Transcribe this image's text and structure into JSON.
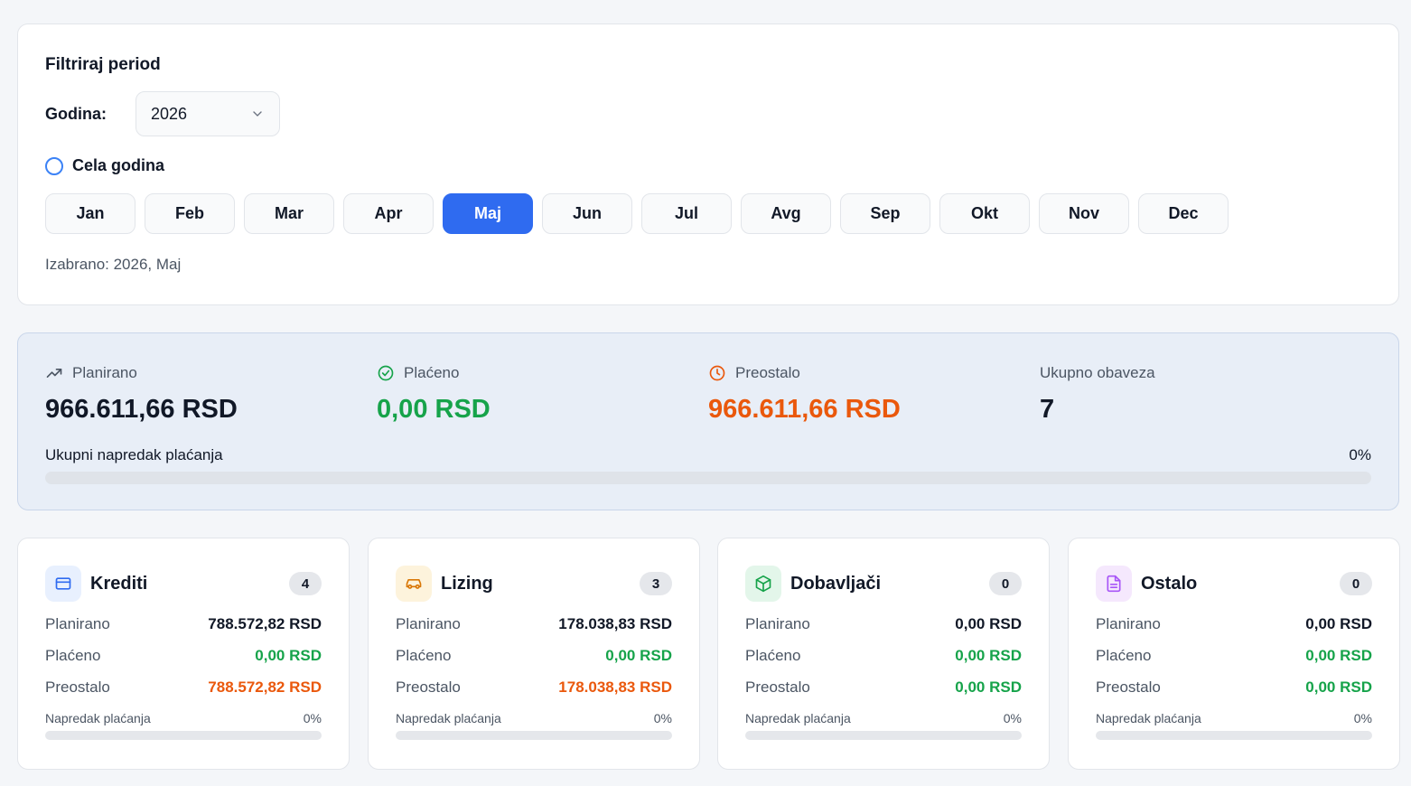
{
  "filter": {
    "title": "Filtriraj period",
    "year_label": "Godina:",
    "year_value": "2026",
    "full_year_label": "Cela godina",
    "months": [
      "Jan",
      "Feb",
      "Mar",
      "Apr",
      "Maj",
      "Jun",
      "Jul",
      "Avg",
      "Sep",
      "Okt",
      "Nov",
      "Dec"
    ],
    "active_month": "Maj",
    "selected_text": "Izabrano: 2026, Maj"
  },
  "summary": {
    "planned_label": "Planirano",
    "planned_value": "966.611,66 RSD",
    "paid_label": "Plaćeno",
    "paid_value": "0,00 RSD",
    "remaining_label": "Preostalo",
    "remaining_value": "966.611,66 RSD",
    "total_label": "Ukupno obaveza",
    "total_value": "7",
    "progress_label": "Ukupni napredak plaćanja",
    "progress_percent": "0%",
    "progress_fraction": 0
  },
  "categories": [
    {
      "title": "Krediti",
      "count": "4",
      "icon": "credit-card-icon",
      "icon_bg": "#e8f0fe",
      "icon_color": "#2f6bf0",
      "planned_label": "Planirano",
      "planned_value": "788.572,82 RSD",
      "paid_label": "Plaćeno",
      "paid_value": "0,00 RSD",
      "remaining_label": "Preostalo",
      "remaining_value": "788.572,82 RSD",
      "remaining_color": "#ea580c",
      "progress_label": "Napredak plaćanja",
      "progress_percent": "0%",
      "progress_fraction": 0
    },
    {
      "title": "Lizing",
      "count": "3",
      "icon": "car-icon",
      "icon_bg": "#fdf3dc",
      "icon_color": "#d97706",
      "planned_label": "Planirano",
      "planned_value": "178.038,83 RSD",
      "paid_label": "Plaćeno",
      "paid_value": "0,00 RSD",
      "remaining_label": "Preostalo",
      "remaining_value": "178.038,83 RSD",
      "remaining_color": "#ea580c",
      "progress_label": "Napredak plaćanja",
      "progress_percent": "0%",
      "progress_fraction": 0
    },
    {
      "title": "Dobavljači",
      "count": "0",
      "icon": "package-icon",
      "icon_bg": "#e3f6ea",
      "icon_color": "#16a34a",
      "planned_label": "Planirano",
      "planned_value": "0,00 RSD",
      "paid_label": "Plaćeno",
      "paid_value": "0,00 RSD",
      "remaining_label": "Preostalo",
      "remaining_value": "0,00 RSD",
      "remaining_color": "#16a34a",
      "progress_label": "Napredak plaćanja",
      "progress_percent": "0%",
      "progress_fraction": 0
    },
    {
      "title": "Ostalo",
      "count": "0",
      "icon": "document-icon",
      "icon_bg": "#f5e8fd",
      "icon_color": "#a855f7",
      "planned_label": "Planirano",
      "planned_value": "0,00 RSD",
      "paid_label": "Plaćeno",
      "paid_value": "0,00 RSD",
      "remaining_label": "Preostalo",
      "remaining_value": "0,00 RSD",
      "remaining_color": "#16a34a",
      "progress_label": "Napredak plaćanja",
      "progress_percent": "0%",
      "progress_fraction": 0
    }
  ]
}
